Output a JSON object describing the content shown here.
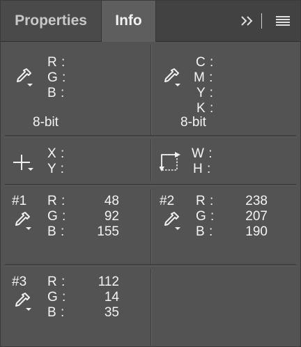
{
  "tabs": {
    "properties": "Properties",
    "info": "Info",
    "active": "Info"
  },
  "toolbar": {
    "collapse_icon": "double-chevron-right-icon",
    "menu_icon": "hamburger-menu-icon"
  },
  "rgb_readout": {
    "icon": "eyedropper-icon",
    "labels": [
      "R :",
      "G :",
      "B :"
    ],
    "bit_depth": "8-bit"
  },
  "cmyk_readout": {
    "icon": "eyedropper-icon",
    "labels": [
      "C :",
      "M :",
      "Y :",
      "K :"
    ],
    "bit_depth": "8-bit"
  },
  "position_readout": {
    "icon": "crosshair-icon",
    "labels": [
      "X :",
      "Y :"
    ]
  },
  "size_readout": {
    "icon": "selection-size-icon",
    "labels": [
      "W :",
      "H :"
    ]
  },
  "samplers": [
    {
      "id": "#1",
      "icon": "eyedropper-icon",
      "labels": [
        "R :",
        "G :",
        "B :"
      ],
      "values": [
        "48",
        "92",
        "155"
      ]
    },
    {
      "id": "#2",
      "icon": "eyedropper-icon",
      "labels": [
        "R :",
        "G :",
        "B :"
      ],
      "values": [
        "238",
        "207",
        "190"
      ]
    },
    {
      "id": "#3",
      "icon": "eyedropper-icon",
      "labels": [
        "R :",
        "G :",
        "B :"
      ],
      "values": [
        "112",
        "14",
        "35"
      ]
    }
  ],
  "colors": {
    "panel_bg": "#535353",
    "tabbar_bg": "#424242",
    "text": "#f4f4f4"
  }
}
